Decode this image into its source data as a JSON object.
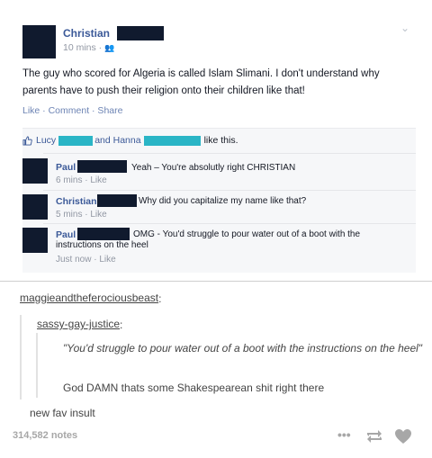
{
  "facebook_post": {
    "author": "Christian",
    "time": "10 mins ·",
    "text": "The guy who scored for Algeria is called Islam Slimani. I don't understand why parents have to push their religion onto their children like that!",
    "actions": "Like · Comment · Share",
    "likes": {
      "name1": "Lucy",
      "and": "and Hanna",
      "suffix": "like this."
    },
    "comments": [
      {
        "name": "Paul",
        "text": "Yeah – You're absolutly right CHRISTIAN",
        "meta": "6 mins · Like"
      },
      {
        "name": "Christian",
        "text": "Why did you capitalize my name like that?",
        "meta": "5 mins · Like"
      },
      {
        "name": "Paul",
        "text": "OMG - You'd struggle to pour water out of a boot with the instructions on the heel",
        "meta": "Just now · Like"
      }
    ],
    "colors": {
      "link": "#3b5998",
      "redaction_dark": "#101a2e",
      "redaction_teal": "#2ab5c6"
    }
  },
  "tumblr": {
    "user1": "maggieandtheferociousbeast",
    "user2": "sassy-gay-justice",
    "quote": "\"You'd struggle to pour water out of a boot with the instructions on the heel\"",
    "reply1": "God DAMN thats some Shakespearean shit right there",
    "reply2": "new fav insult",
    "notes": "314,582 notes",
    "icons": [
      "more-icon",
      "reblog-icon",
      "heart-icon"
    ]
  }
}
